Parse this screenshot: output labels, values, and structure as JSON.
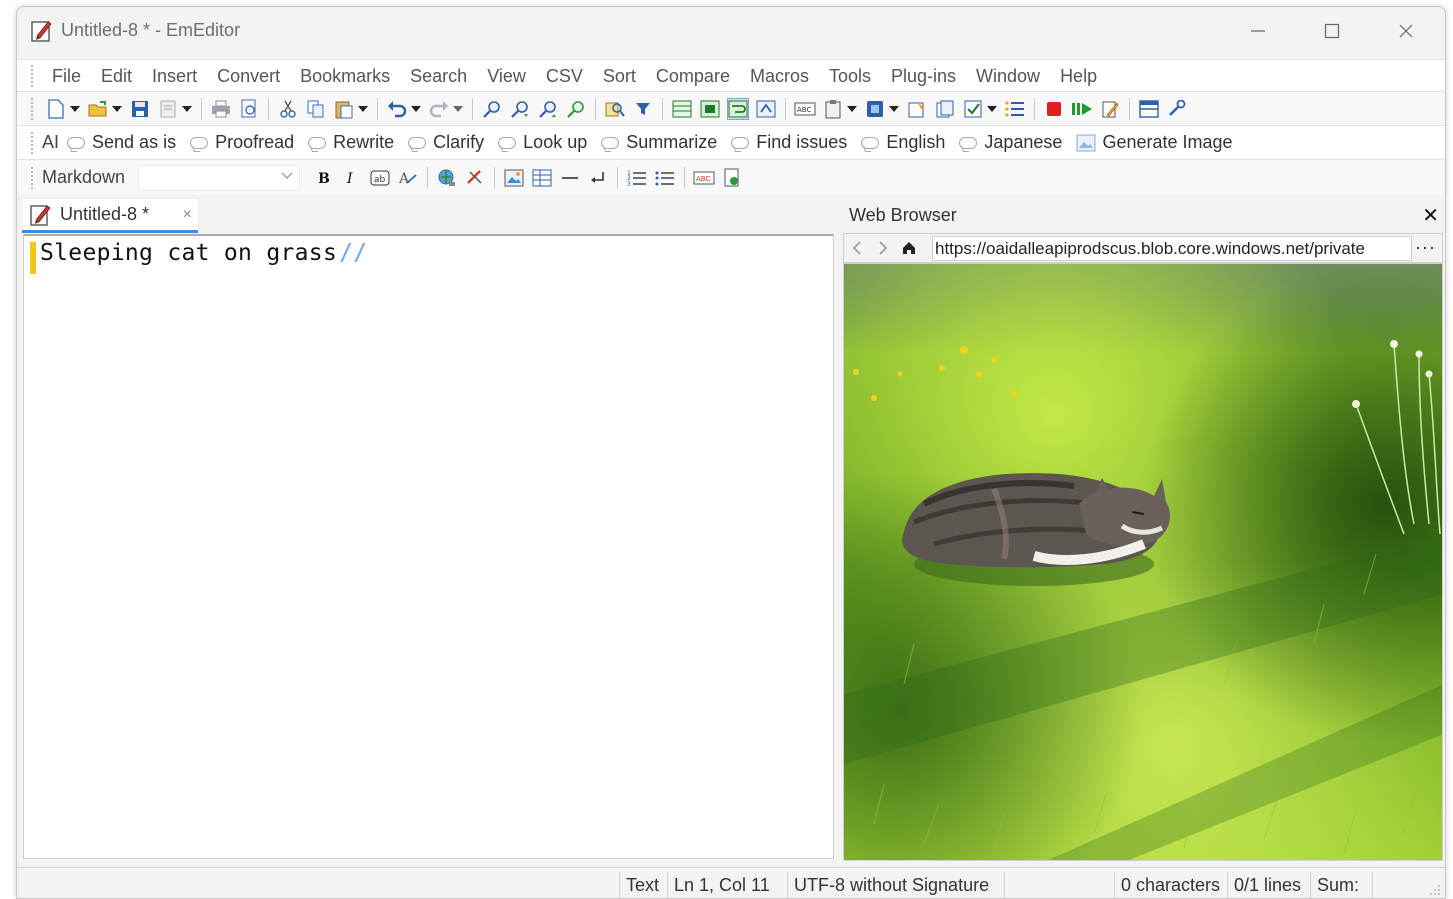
{
  "window": {
    "title": "Untitled-8 * - EmEditor",
    "minimize_symbol": "—",
    "maximize_symbol": "☐",
    "close_symbol": "✕"
  },
  "menu": [
    "File",
    "Edit",
    "Insert",
    "Convert",
    "Bookmarks",
    "Search",
    "View",
    "CSV",
    "Sort",
    "Compare",
    "Macros",
    "Tools",
    "Plug-ins",
    "Window",
    "Help"
  ],
  "ai_bar": {
    "label": "AI",
    "buttons": [
      "Send as is",
      "Proofread",
      "Rewrite",
      "Clarify",
      "Look up",
      "Summarize",
      "Find issues",
      "English",
      "Japanese"
    ],
    "generate_image": "Generate Image"
  },
  "format_bar": {
    "mode_label": "Markdown",
    "mode_value": ""
  },
  "tab": {
    "label": "Untitled-8 *",
    "close_symbol": "×"
  },
  "editor": {
    "text": "Sleeping cat on grass",
    "eol": "//"
  },
  "browser": {
    "title": "Web Browser",
    "close_symbol": "✕",
    "url": "https://oaidalleapiprodscus.blob.core.windows.net/private",
    "more": "···",
    "back_symbol": "‹",
    "forward_symbol": "›",
    "home_symbol": "⌂"
  },
  "status": {
    "mode": "Text",
    "position": "Ln 1, Col 11",
    "encoding": "UTF-8 without Signature",
    "characters": "0 characters",
    "lines": "0/1 lines",
    "sum": "Sum:"
  },
  "colors": {
    "accent": "#3c8ce0",
    "gutter_mark": "#f5c518",
    "grass_light": "#a8d43a",
    "grass_dark": "#2f6a16"
  }
}
